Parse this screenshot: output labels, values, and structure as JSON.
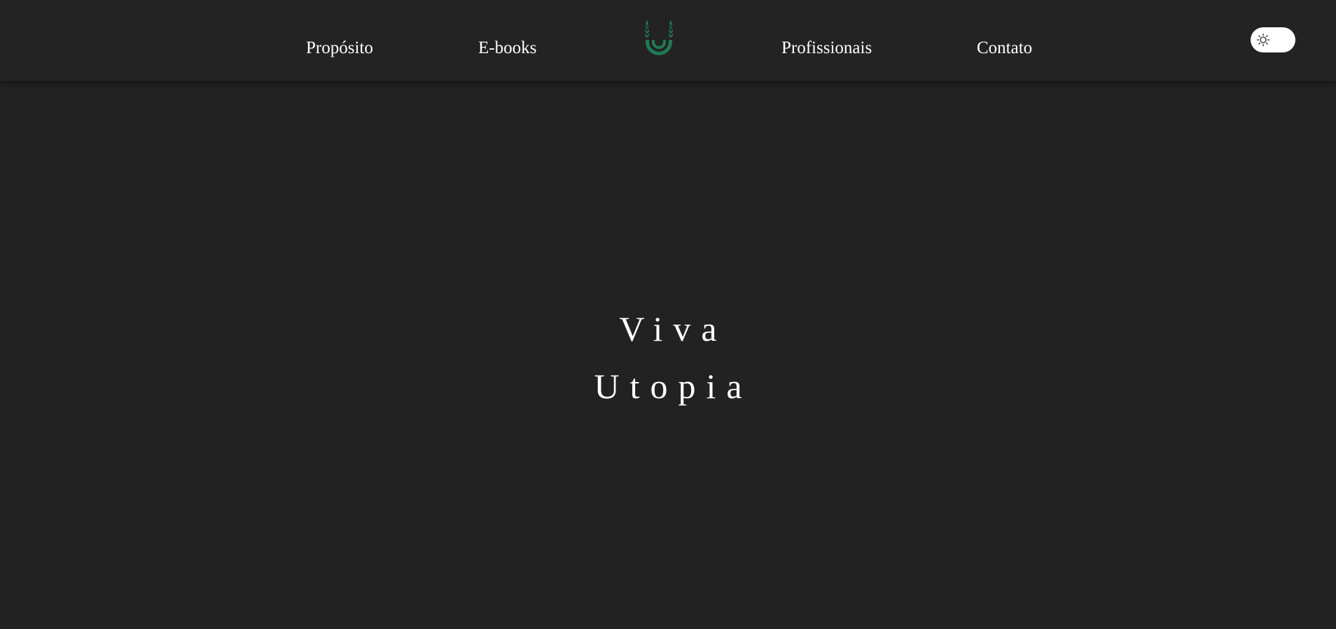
{
  "header": {
    "nav": {
      "proposito": "Propósito",
      "ebooks": "E-books",
      "profissionais": "Profissionais",
      "contato": "Contato"
    },
    "logo_icon": "wheat-u-logo-icon",
    "theme_toggle_icon": "sun-icon"
  },
  "hero": {
    "line1": "Viva",
    "line2": "Utopia"
  },
  "colors": {
    "background": "#222222",
    "header_background": "#232323",
    "text": "#ffffff",
    "brand_green": "#1f7a55",
    "toggle_background": "#ffffff"
  }
}
